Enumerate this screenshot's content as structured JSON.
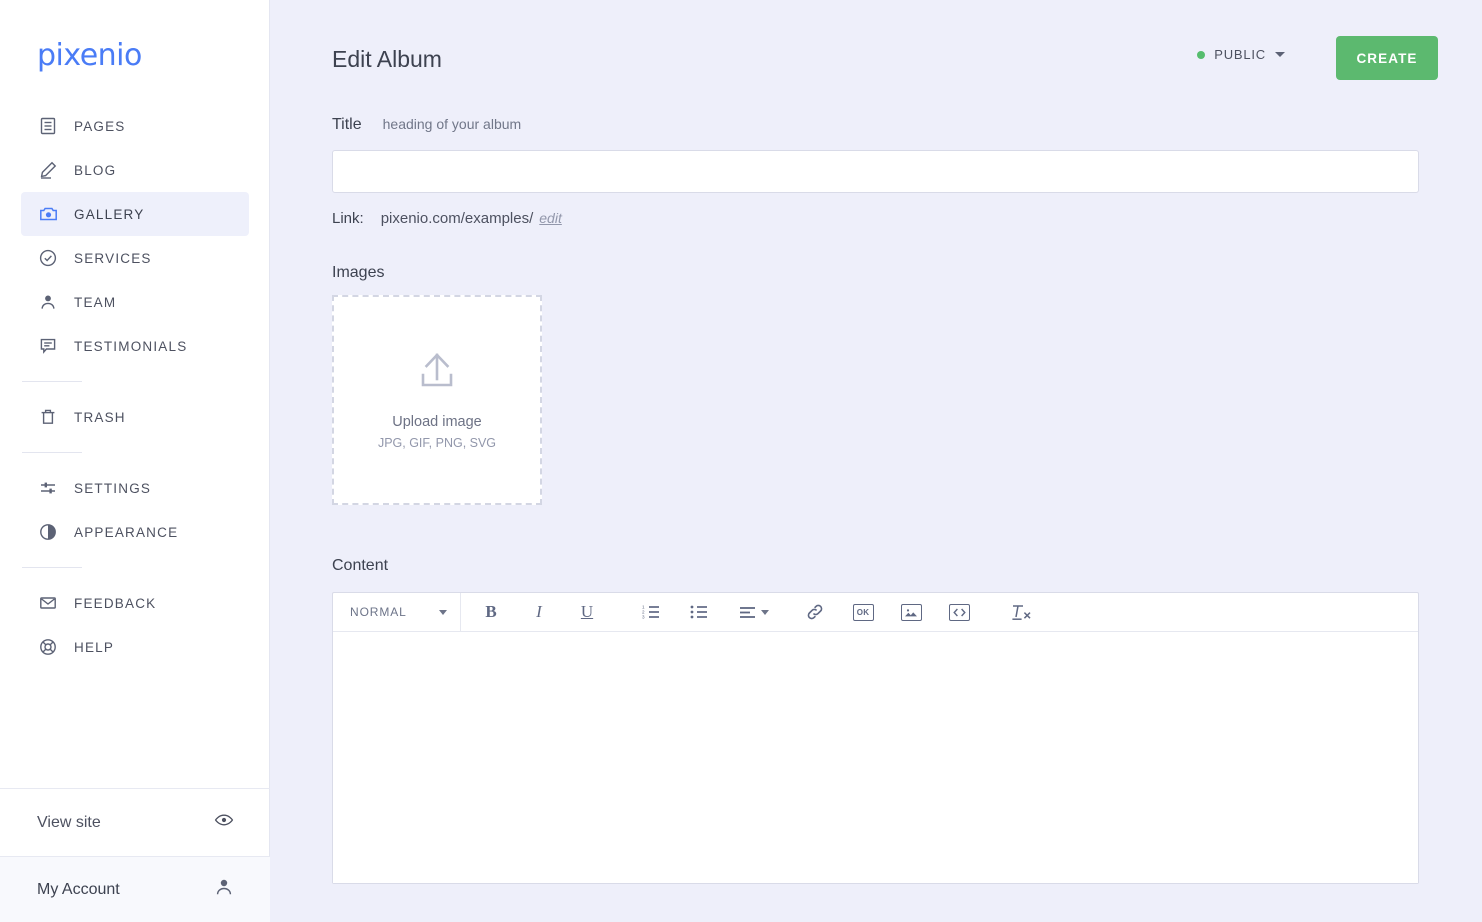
{
  "brand": {
    "name": "pixenio"
  },
  "sidebar": {
    "items": [
      {
        "label": "PAGES",
        "icon": "pages-icon",
        "active": false
      },
      {
        "label": "BLOG",
        "icon": "pencil-icon",
        "active": false
      },
      {
        "label": "GALLERY",
        "icon": "camera-icon",
        "active": true
      },
      {
        "label": "SERVICES",
        "icon": "check-circle-icon",
        "active": false
      },
      {
        "label": "TEAM",
        "icon": "person-icon",
        "active": false
      },
      {
        "label": "TESTIMONIALS",
        "icon": "speech-bubble-icon",
        "active": false
      },
      {
        "label": "TRASH",
        "icon": "trash-icon",
        "active": false
      },
      {
        "label": "SETTINGS",
        "icon": "sliders-icon",
        "active": false
      },
      {
        "label": "APPEARANCE",
        "icon": "contrast-circle-icon",
        "active": false
      },
      {
        "label": "FEEDBACK",
        "icon": "envelope-icon",
        "active": false
      },
      {
        "label": "HELP",
        "icon": "lifebuoy-icon",
        "active": false
      }
    ],
    "view_site": {
      "label": "View site",
      "icon": "eye-icon"
    },
    "account": {
      "label": "My Account",
      "icon": "person-icon"
    }
  },
  "header": {
    "title": "Edit Album",
    "visibility": {
      "label": "PUBLIC",
      "dot_color": "#56bd6e",
      "caret": "chevron-down-icon"
    },
    "create_button": {
      "label": "CREATE",
      "color": "#5cb96f"
    }
  },
  "form": {
    "title_field": {
      "label": "Title",
      "hint": "heading of your album",
      "value": "",
      "placeholder": ""
    },
    "link": {
      "label": "Link:",
      "url": "pixenio.com/examples/",
      "edit_label": "edit"
    },
    "images": {
      "label": "Images",
      "dropzone": {
        "icon": "upload-icon",
        "primary": "Upload image",
        "formats": "JPG, GIF, PNG, SVG"
      }
    },
    "content": {
      "label": "Content",
      "value": "",
      "toolbar": {
        "style_select": {
          "value": "NORMAL"
        },
        "buttons": [
          {
            "name": "bold-button",
            "label": "B"
          },
          {
            "name": "italic-button",
            "label": "I"
          },
          {
            "name": "underline-button",
            "label": "U"
          },
          {
            "name": "ordered-list-button",
            "label": ""
          },
          {
            "name": "bullet-list-button",
            "label": ""
          },
          {
            "name": "align-button",
            "label": ""
          },
          {
            "name": "link-button",
            "label": ""
          },
          {
            "name": "ok-button",
            "label": "OK"
          },
          {
            "name": "image-button",
            "label": ""
          },
          {
            "name": "code-button",
            "label": ""
          },
          {
            "name": "clear-format-button",
            "label": "T"
          }
        ]
      }
    }
  }
}
